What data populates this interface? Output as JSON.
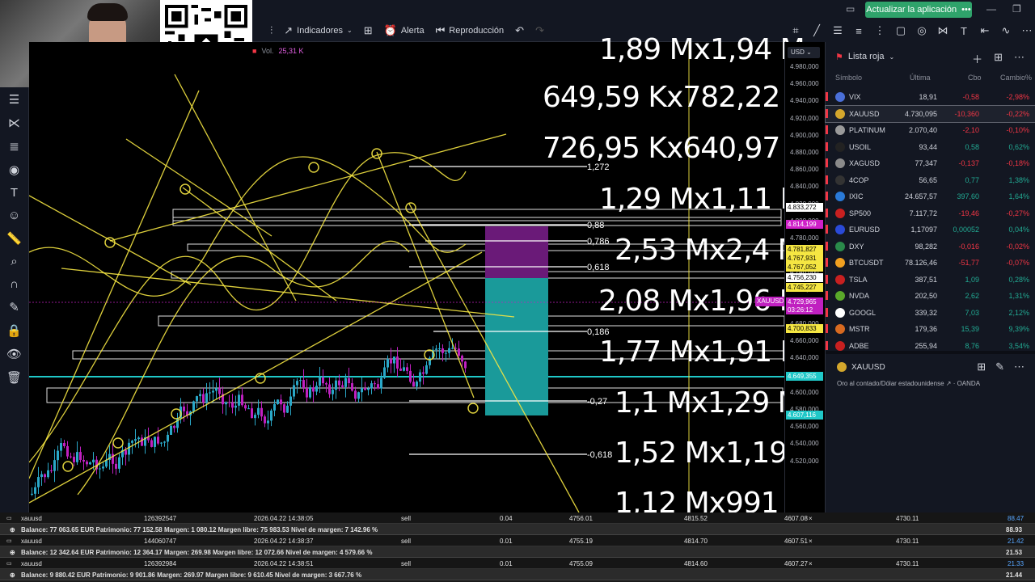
{
  "topbar": {
    "update_label": "Actualizar la aplicación"
  },
  "toolbar": {
    "indicators_label": "Indicadores",
    "alert_label": "Alerta",
    "replay_label": "Reproducción"
  },
  "chart": {
    "vol_label": "Vol.",
    "vol_value": "25,31 K",
    "fib_labels": [
      "1,272",
      "0,88",
      "0,786",
      "0,618",
      "0,186",
      "-0,27",
      "-0,618"
    ],
    "big_labels": [
      "1,89 Mx1,94 M",
      "649,59 Kx782,22 K",
      "726,95 Kx640,97 K",
      "1,29 Mx1,11 M",
      "2,53 Mx2,4 M",
      "2,08 Mx1,96 M",
      "1,77 Mx1,91 M",
      "1,1 Mx1,29 M",
      "1,52 Mx1,19 M",
      "1,12 Mx991 K"
    ]
  },
  "axis": {
    "currency": "USD",
    "ticks": [
      "4.980,000",
      "4.960,000",
      "4.940,000",
      "4.920,000",
      "4.900,000",
      "4.880,000",
      "4.860,000",
      "4.840,000",
      "4.820,000",
      "4.800,000",
      "4.780,000",
      "4.760,000",
      "4.740,000",
      "4.720,000",
      "4.700,000",
      "4.680,000",
      "4.660,000",
      "4.640,000",
      "4.620,000",
      "4.600,000",
      "4.580,000",
      "4.560,000",
      "4.540,000",
      "4.520,000"
    ],
    "tags": [
      {
        "text": "4.833,272",
        "color": "#ffffff"
      },
      {
        "text": "4.814,199",
        "color": "#d020c8"
      },
      {
        "text": "4.781,827",
        "color": "#f5e642"
      },
      {
        "text": "4.767,931",
        "color": "#f5e642"
      },
      {
        "text": "4.767,052",
        "color": "#f5e642"
      },
      {
        "text": "4.756,230",
        "color": "#ffffff"
      },
      {
        "text": "4.745,227",
        "color": "#f5e642"
      },
      {
        "text": "4.729,965",
        "color": "#c020c0"
      },
      {
        "text": "03:26:12",
        "color": "#c020c0"
      },
      {
        "text": "4.700,833",
        "color": "#f5e642"
      },
      {
        "text": "4.649,355",
        "color": "#20c8c8"
      },
      {
        "text": "4.607,116",
        "color": "#20c8c8"
      }
    ],
    "symbol_tag": "XAUUSD"
  },
  "watchlist": {
    "title": "Lista roja",
    "columns": {
      "symbol": "Símbolo",
      "last": "Última",
      "chg": "Cbo",
      "pct": "Cambio%"
    },
    "rows": [
      {
        "sym": "VIX",
        "last": "18,91",
        "chg": "-0,58",
        "pct": "-2,98%",
        "dir": "neg",
        "ico": "#4a6fd8"
      },
      {
        "sym": "XAUUSD",
        "last": "4.730,095",
        "chg": "-10,360",
        "pct": "-0,22%",
        "dir": "neg",
        "ico": "#d4a72c"
      },
      {
        "sym": "PLATINUM",
        "last": "2.070,40",
        "chg": "-2,10",
        "pct": "-0,10%",
        "dir": "neg",
        "ico": "#9a9a9a"
      },
      {
        "sym": "USOIL",
        "last": "93,44",
        "chg": "0,58",
        "pct": "0,62%",
        "dir": "pos",
        "ico": "#222222"
      },
      {
        "sym": "XAGUSD",
        "last": "77,347",
        "chg": "-0,137",
        "pct": "-0,18%",
        "dir": "neg",
        "ico": "#8a8a8a"
      },
      {
        "sym": "4COP",
        "last": "56,65",
        "chg": "0,77",
        "pct": "1,38%",
        "dir": "pos",
        "ico": "#333333"
      },
      {
        "sym": "IXIC",
        "last": "24.657,57",
        "chg": "397,60",
        "pct": "1,64%",
        "dir": "pos",
        "ico": "#2a7ad8"
      },
      {
        "sym": "SP500",
        "last": "7.117,72",
        "chg": "-19,46",
        "pct": "-0,27%",
        "dir": "neg",
        "ico": "#c82020"
      },
      {
        "sym": "EURUSD",
        "last": "1,17097",
        "chg": "0,00052",
        "pct": "0,04%",
        "dir": "pos",
        "ico": "#2a4ad8"
      },
      {
        "sym": "DXY",
        "last": "98,282",
        "chg": "-0,016",
        "pct": "-0,02%",
        "dir": "neg",
        "ico": "#2a8a4a"
      },
      {
        "sym": "BTCUSDT",
        "last": "78.126,46",
        "chg": "-51,77",
        "pct": "-0,07%",
        "dir": "neg",
        "ico": "#f0a020"
      },
      {
        "sym": "TSLA",
        "last": "387,51",
        "chg": "1,09",
        "pct": "0,28%",
        "dir": "pos",
        "ico": "#c82020"
      },
      {
        "sym": "NVDA",
        "last": "202,50",
        "chg": "2,62",
        "pct": "1,31%",
        "dir": "pos",
        "ico": "#5aa82a"
      },
      {
        "sym": "GOOGL",
        "last": "339,32",
        "chg": "7,03",
        "pct": "2,12%",
        "dir": "pos",
        "ico": "#ffffff"
      },
      {
        "sym": "MSTR",
        "last": "179,36",
        "chg": "15,39",
        "pct": "9,39%",
        "dir": "pos",
        "ico": "#d86a20"
      },
      {
        "sym": "ADBE",
        "last": "255,94",
        "chg": "8,76",
        "pct": "3,54%",
        "dir": "pos",
        "ico": "#c82020"
      }
    ],
    "detail": {
      "symbol": "XAUUSD",
      "subtitle": "Oro al contado/Dólar estadounidense",
      "broker": "OANDA"
    }
  },
  "bottom": {
    "rows": [
      {
        "type": "ord",
        "cells": [
          "xauusd",
          "126392547",
          "2026.04.22 14:38:05",
          "sell",
          "0.04",
          "4756.01",
          "4815.52",
          "4607.08",
          "4730.11",
          "88.47"
        ]
      },
      {
        "type": "bal",
        "text": "Balance: 77 063.65 EUR  Patrimonio: 77 152.58  Margen: 1 080.12  Margen libre: 75 983.53  Nivel de margen: 7 142.96 %",
        "val": "88.93"
      },
      {
        "type": "ord",
        "cells": [
          "xauusd",
          "144060747",
          "2026.04.22 14:38:37",
          "sell",
          "0.01",
          "4755.19",
          "4814.70",
          "4607.51",
          "4730.11",
          "21.42"
        ]
      },
      {
        "type": "bal",
        "text": "Balance: 12 342.64 EUR  Patrimonio: 12 364.17  Margen: 269.98  Margen libre: 12 072.66  Nivel de margen: 4 579.66 %",
        "val": "21.53"
      },
      {
        "type": "ord",
        "cells": [
          "xauusd",
          "126392984",
          "2026.04.22 14:38:51",
          "sell",
          "0.01",
          "4755.09",
          "4814.60",
          "4607.27",
          "4730.11",
          "21.33"
        ]
      },
      {
        "type": "bal",
        "text": "Balance: 9 880.42 EUR  Patrimonio: 9 901.86  Margen: 269.97  Margen libre: 9 610.45  Nivel de margen: 3 667.76 %",
        "val": "21.44"
      }
    ]
  }
}
